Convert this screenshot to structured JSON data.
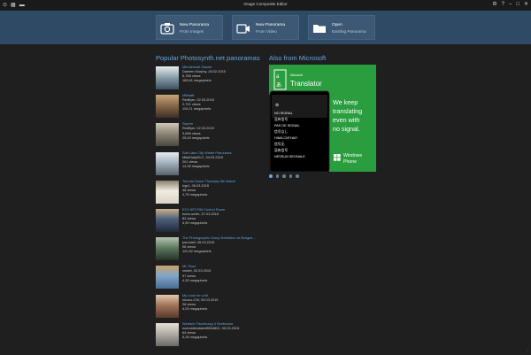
{
  "window": {
    "title": "Image Composite Editor"
  },
  "titlebar": {
    "left_icons": [
      "new-panorama-icon",
      "open-panorama-icon",
      "folder-icon"
    ],
    "right_icons": [
      "gear-icon",
      "help-icon",
      "minimize-icon",
      "maximize-icon",
      "close-icon"
    ]
  },
  "toolbar": {
    "tiles": [
      {
        "line1": "New Panorama",
        "line2": "From Images",
        "icon": "camera-icon"
      },
      {
        "line1": "New Panorama",
        "line2": "From Video",
        "icon": "video-icon"
      },
      {
        "line1": "Open",
        "line2": "Existing Panorama",
        "icon": "folder-icon"
      }
    ]
  },
  "sections": {
    "popular_title": "Popular Photosynth.net panoramas",
    "ad_title": "Also from Microsoft"
  },
  "panoramas": [
    {
      "name": "Mendenhall Glacier",
      "info": [
        "Damien Murphy, 28.02.2015",
        "5,786 views",
        "168,61 megapixels"
      ],
      "thumb": [
        "#3a5060",
        "#8fa3ad",
        "#e7ecee"
      ]
    },
    {
      "name": "Millstatt",
      "info": [
        "Redflyer, 02.03.2015",
        "2,701 views",
        "119,21 megapixels"
      ],
      "thumb": [
        "#3e2f28",
        "#8a6a4a",
        "#c9a679"
      ]
    },
    {
      "name": "Skyrim",
      "info": [
        "Redflyer, 02.03.2015",
        "3,656 views",
        "25,49 megapixels"
      ],
      "thumb": [
        "#4b4842",
        "#8e8677",
        "#cfc8b9"
      ]
    },
    {
      "name": "Salt Lake City Winter Panorama",
      "info": [
        "MikeDailySLC, 04.03.2015",
        "201 views",
        "14,35 megapixels"
      ],
      "thumb": [
        "#58626c",
        "#a5b3bf",
        "#e6ecf1"
      ]
    },
    {
      "name": "Toronto Dome Thursday 5th March",
      "info": [
        "lvgr1, 06.03.2015",
        "48 views",
        "4,75 megapixels"
      ],
      "thumb": [
        "#d9d3c4",
        "#f0ece2",
        "#8a7f6d"
      ]
    },
    {
      "name": "EC1 NF2 RM Control Room",
      "info": [
        "turbo-smith, 07.03.2015",
        "83 views",
        "4,90 megapixels"
      ],
      "thumb": [
        "#1f2a3a",
        "#4c5e7a",
        "#c8b18a"
      ]
    },
    {
      "name": "The Photographic Group Exhibition at Sturges...",
      "info": [
        "jonrodell, 05.03.2015",
        "96 views",
        "120,52 megapixels"
      ],
      "thumb": [
        "#243127",
        "#5e7a5f",
        "#b7c4b4"
      ]
    },
    {
      "name": "Mt. Pose",
      "info": [
        "vmdet, 02.03.2015",
        "97 views",
        "4,30 megapixels"
      ],
      "thumb": [
        "#4a6c8f",
        "#7fa6c9",
        "#c9a36b"
      ]
    },
    {
      "name": "My room for a bit",
      "info": [
        "nicoco-CW, 03.03.2015",
        "26 views",
        "4,03 megapixels"
      ],
      "thumb": [
        "#5a3a2a",
        "#a1745a",
        "#e3c9ae"
      ]
    },
    {
      "name": "Wertach Fischerzug 3 Seebrucke",
      "info": [
        "noemidbindabel5534801, 05.03.2015",
        "64 views",
        "5,28 megapixels"
      ],
      "thumb": [
        "#6c6a66",
        "#b3aea5",
        "#e6e2da"
      ]
    }
  ],
  "ad": {
    "brand": "Microsoft",
    "app": "Translator",
    "tagline": [
      "We keep",
      "translating",
      "even with",
      "no signal."
    ],
    "phone_texts": [
      "NO SIGNAL",
      "没有信号",
      "PAS DE SIGNAL",
      "信号なし",
      "HIMA CИГHAЛ",
      "信号无",
      "没有信号",
      "NESSUN SEGNALE"
    ],
    "product": [
      "Windows",
      "Phone"
    ],
    "accent": "#2a9d3f"
  },
  "carousel": {
    "count": 5,
    "active": 0
  }
}
